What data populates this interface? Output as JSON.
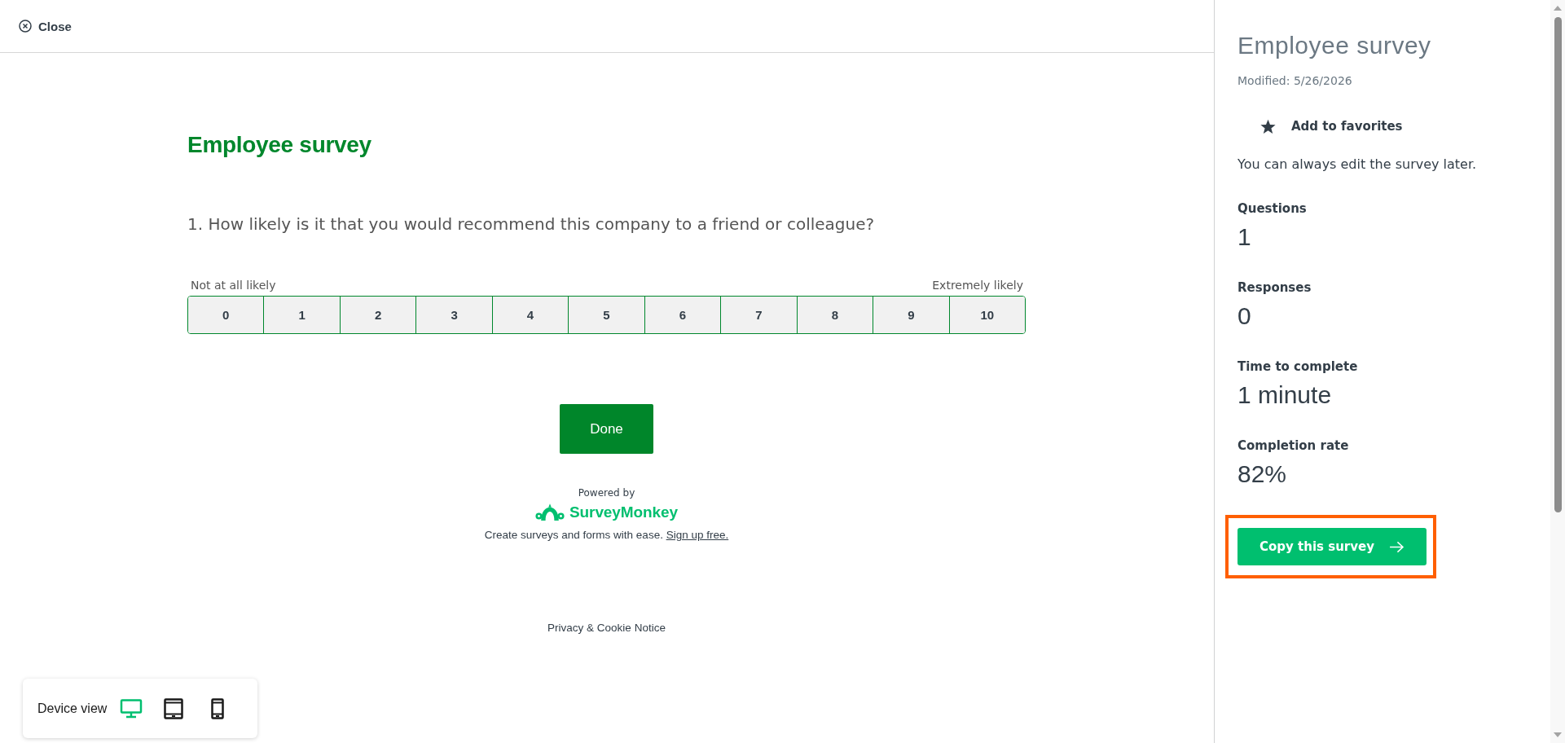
{
  "top_bar": {
    "close_label": "Close"
  },
  "survey": {
    "title": "Employee survey",
    "question": "1. How likely is it that you would recommend this company to a friend or colleague?",
    "scale": {
      "min_label": "Not at all likely",
      "max_label": "Extremely likely",
      "options": [
        {
          "label": "0",
          "selected": false
        },
        {
          "label": "1",
          "selected": false
        },
        {
          "label": "2",
          "selected": false
        },
        {
          "label": "3",
          "selected": false
        },
        {
          "label": "4",
          "selected": false
        },
        {
          "label": "5",
          "selected": false
        },
        {
          "label": "6",
          "selected": false
        },
        {
          "label": "7",
          "selected": false
        },
        {
          "label": "8",
          "selected": false
        },
        {
          "label": "9",
          "selected": false
        },
        {
          "label": "10",
          "selected": false
        }
      ]
    },
    "submit_button": "Done"
  },
  "footer": {
    "powered_by": "Powered by",
    "brand": "SurveyMonkey",
    "tagline": "Create surveys and forms with ease.",
    "signup_link": "Sign up free.",
    "privacy_link": "Privacy & Cookie Notice"
  },
  "device_view": {
    "label": "Device view",
    "devices": [
      {
        "kind": "desktop",
        "selected": true
      },
      {
        "kind": "tablet",
        "selected": false
      },
      {
        "kind": "phone",
        "selected": false
      }
    ]
  },
  "details_panel": {
    "title": "Employee survey",
    "modified": "Modified: 5/26/2026",
    "favorite_label": "Add to favorites",
    "note": "You can always edit the survey later.",
    "stats": [
      {
        "label": "Questions",
        "value": "1"
      },
      {
        "label": "Responses",
        "value": "0"
      },
      {
        "label": "Time to complete",
        "value": "1 minute"
      },
      {
        "label": "Completion rate",
        "value": "82%"
      }
    ],
    "copy_button": {
      "label": "Copy this survey",
      "highlighted": true
    }
  }
}
